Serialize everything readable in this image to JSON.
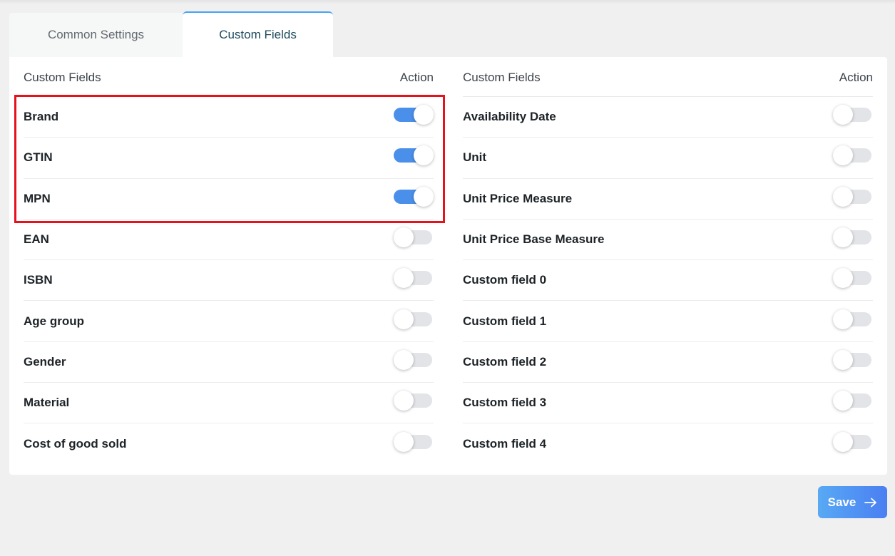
{
  "tabs": [
    {
      "label": "Common Settings",
      "active": false
    },
    {
      "label": "Custom Fields",
      "active": true
    }
  ],
  "left_column": {
    "header_field": "Custom Fields",
    "header_action": "Action",
    "rows": [
      {
        "label": "Brand",
        "enabled": true
      },
      {
        "label": "GTIN",
        "enabled": true
      },
      {
        "label": "MPN",
        "enabled": true
      },
      {
        "label": "EAN",
        "enabled": false
      },
      {
        "label": "ISBN",
        "enabled": false
      },
      {
        "label": "Age group",
        "enabled": false
      },
      {
        "label": "Gender",
        "enabled": false
      },
      {
        "label": "Material",
        "enabled": false
      },
      {
        "label": "Cost of good sold",
        "enabled": false
      }
    ]
  },
  "right_column": {
    "header_field": "Custom Fields",
    "header_action": "Action",
    "rows": [
      {
        "label": "Availability Date",
        "enabled": false
      },
      {
        "label": "Unit",
        "enabled": false
      },
      {
        "label": "Unit Price Measure",
        "enabled": false
      },
      {
        "label": "Unit Price Base Measure",
        "enabled": false
      },
      {
        "label": "Custom field 0",
        "enabled": false
      },
      {
        "label": "Custom field 1",
        "enabled": false
      },
      {
        "label": "Custom field 2",
        "enabled": false
      },
      {
        "label": "Custom field 3",
        "enabled": false
      },
      {
        "label": "Custom field 4",
        "enabled": false
      }
    ]
  },
  "save_button": {
    "label": "Save",
    "icon": "arrow-right-icon"
  },
  "colors": {
    "toggle_on": "#4a8fe9",
    "toggle_off": "#e2e4e7",
    "highlight": "#e8101a",
    "tab_accent": "#45a4f3"
  }
}
